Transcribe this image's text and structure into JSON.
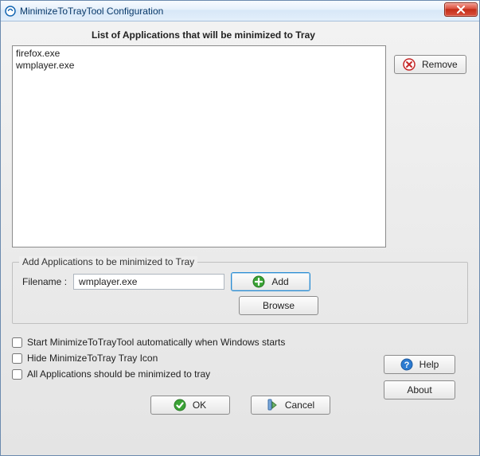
{
  "window": {
    "title": "MinimizeToTrayTool Configuration"
  },
  "header": {
    "listLabel": "List of Applications that will be minimized to Tray"
  },
  "appList": [
    "firefox.exe",
    "wmplayer.exe"
  ],
  "buttons": {
    "remove": "Remove",
    "add": "Add",
    "browse": "Browse",
    "help": "Help",
    "about": "About",
    "ok": "OK",
    "cancel": "Cancel"
  },
  "addGroup": {
    "legend": "Add Applications to be minimized to Tray",
    "filenameLabel": "Filename :",
    "filenameValue": "wmplayer.exe"
  },
  "options": {
    "autostart": {
      "label": "Start MinimizeToTrayTool automatically when Windows starts",
      "checked": false
    },
    "hideIcon": {
      "label": "Hide MinimizeToTray Tray Icon",
      "checked": false
    },
    "allApps": {
      "label": "All Applications should be minimized to tray",
      "checked": false
    }
  }
}
